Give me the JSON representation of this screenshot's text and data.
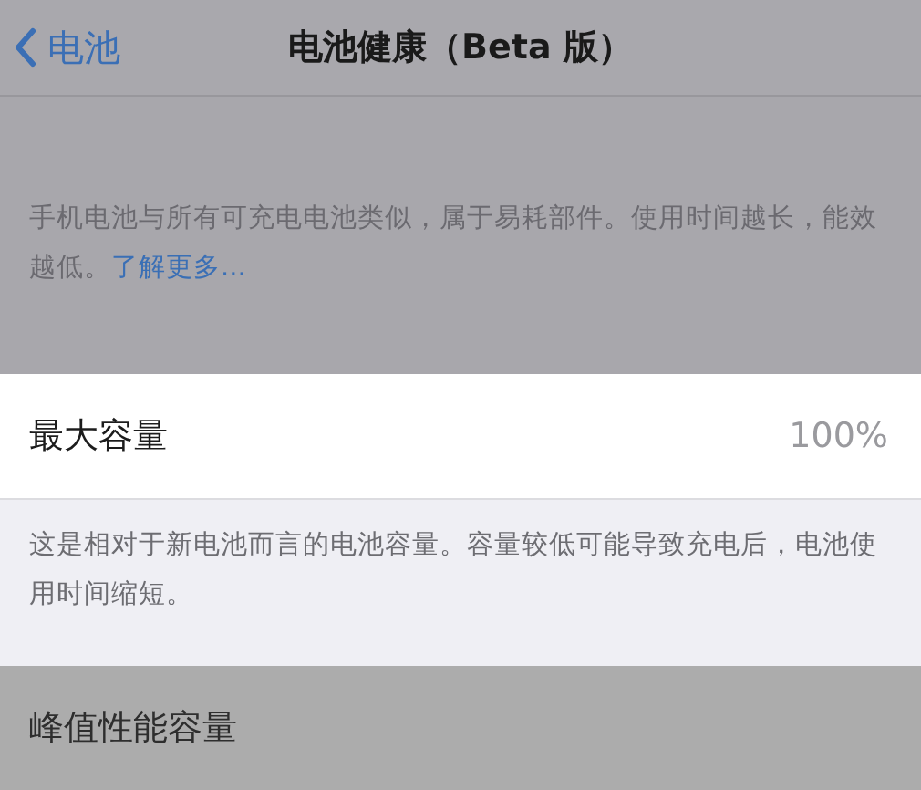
{
  "nav": {
    "back": "电池",
    "title": "电池健康（Beta 版）"
  },
  "intro": {
    "text": "手机电池与所有可充电电池类似，属于易耗部件。使用时间越长，能效越低。",
    "link": "了解更多..."
  },
  "rows": [
    {
      "label": "最大容量",
      "value": "100%",
      "dimmed": false,
      "footer": "这是相对于新电池而言的电池容量。容量较低可能导致充电后，电池使用时间缩短。"
    },
    {
      "label": "峰值性能容量",
      "dimmed": true
    }
  ]
}
